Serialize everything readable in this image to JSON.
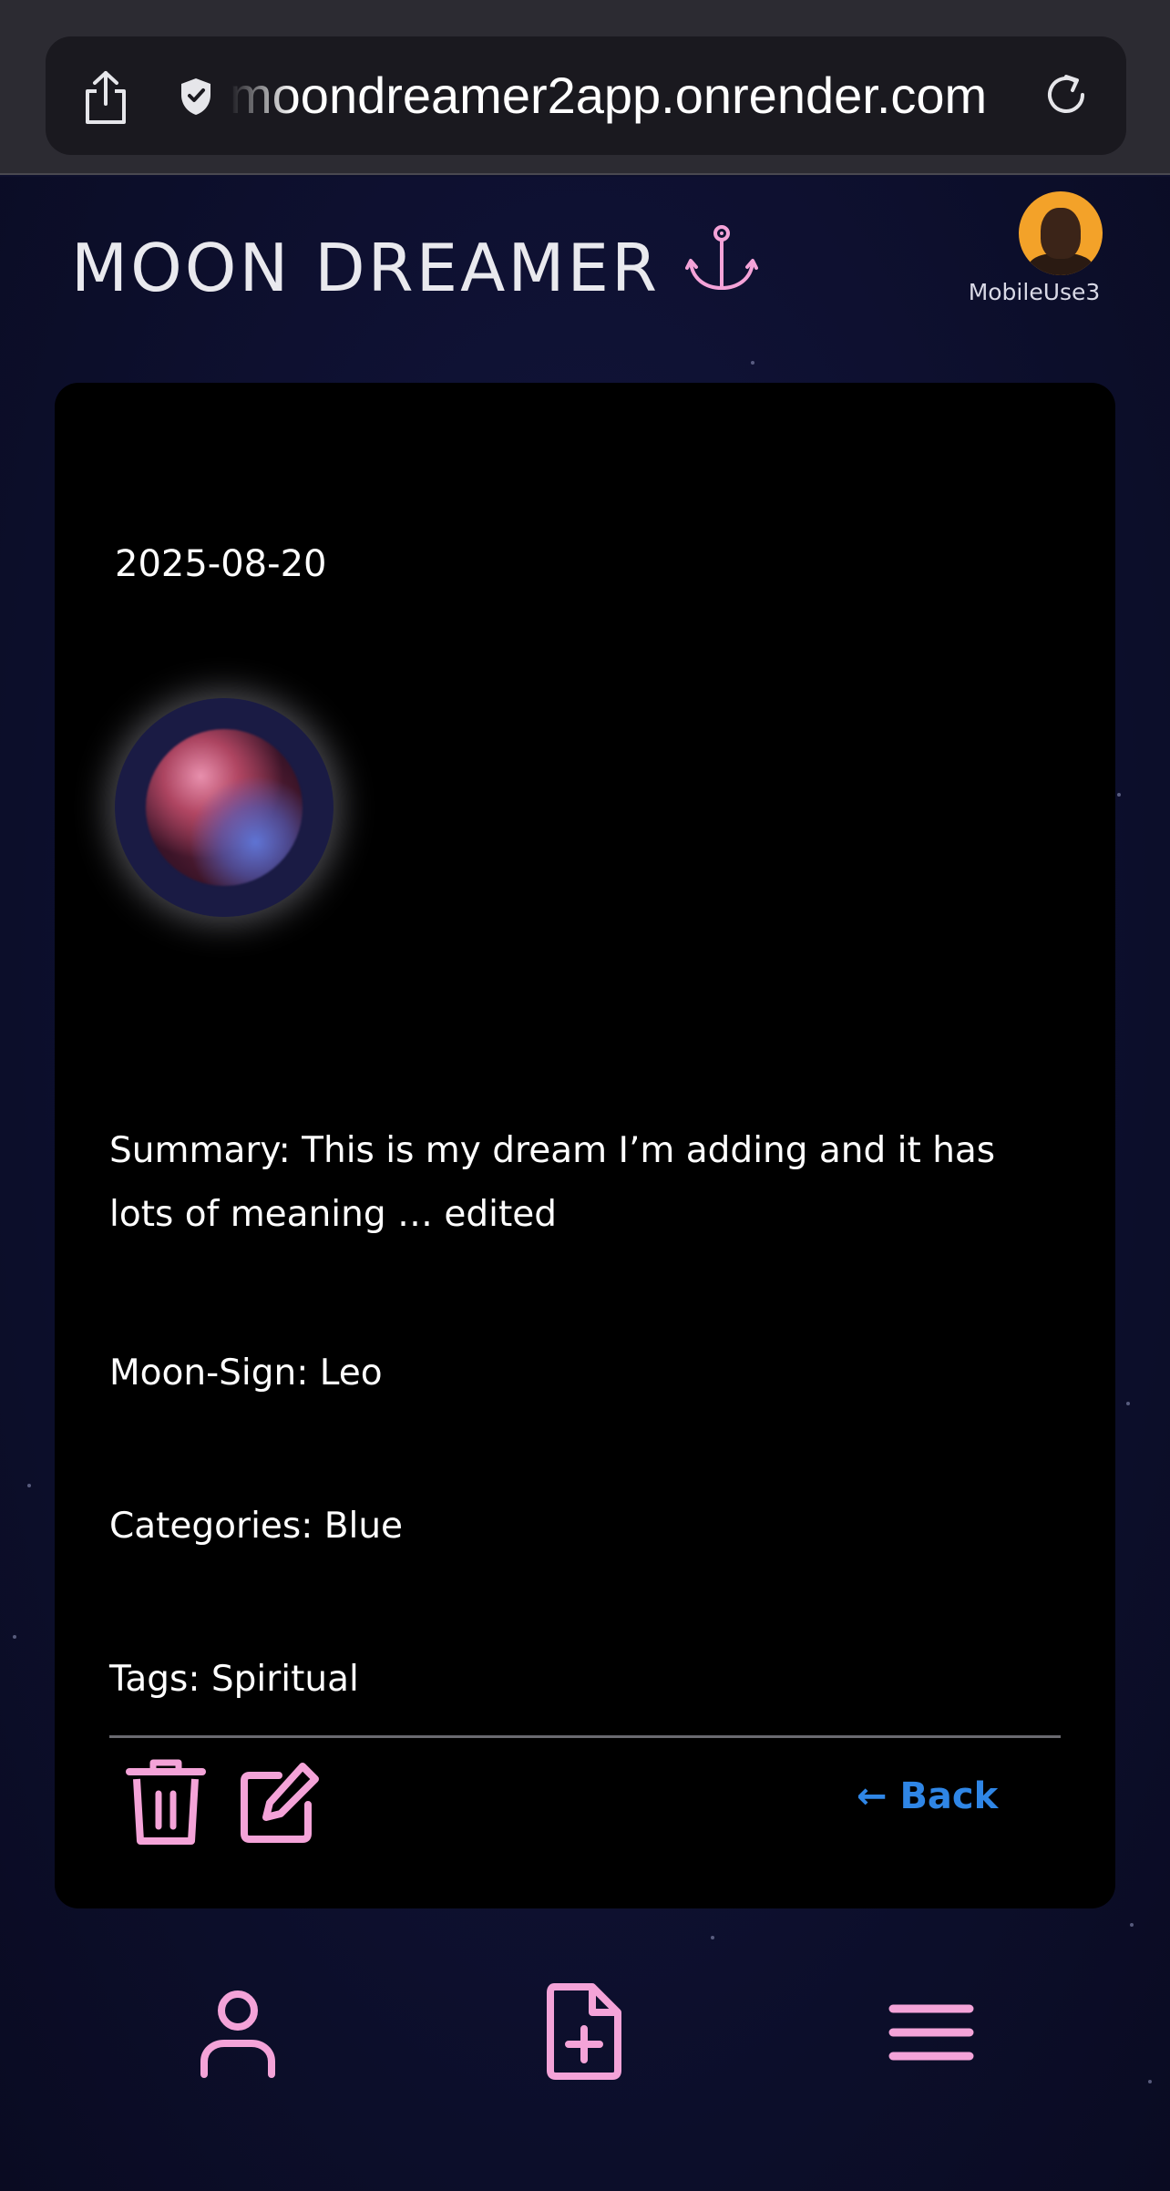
{
  "browser": {
    "url": "moondreamer2app.onrender.com",
    "icons": [
      "share-icon",
      "shield-icon",
      "reload-icon"
    ]
  },
  "header": {
    "app_title": "MOON DREAMER",
    "logo_icon": "anchor-icon",
    "username": "MobileUse3"
  },
  "dream": {
    "date": "2025-08-20",
    "summary": "Summary: This is my dream I’m adding and it has lots of meaning … edited",
    "moon_sign": "Moon-Sign: Leo",
    "categories": "Categories: Blue",
    "tags": "Tags: Spiritual"
  },
  "actions": {
    "delete_icon": "trash-icon",
    "edit_icon": "edit-icon",
    "back_label": "← Back"
  },
  "bottom_nav": {
    "items": [
      "profile-icon",
      "add-document-icon",
      "menu-icon"
    ]
  },
  "colors": {
    "accent": "#f4a3d8",
    "link": "#2f86e6",
    "background": "#0d0f2c",
    "card": "#000000"
  }
}
